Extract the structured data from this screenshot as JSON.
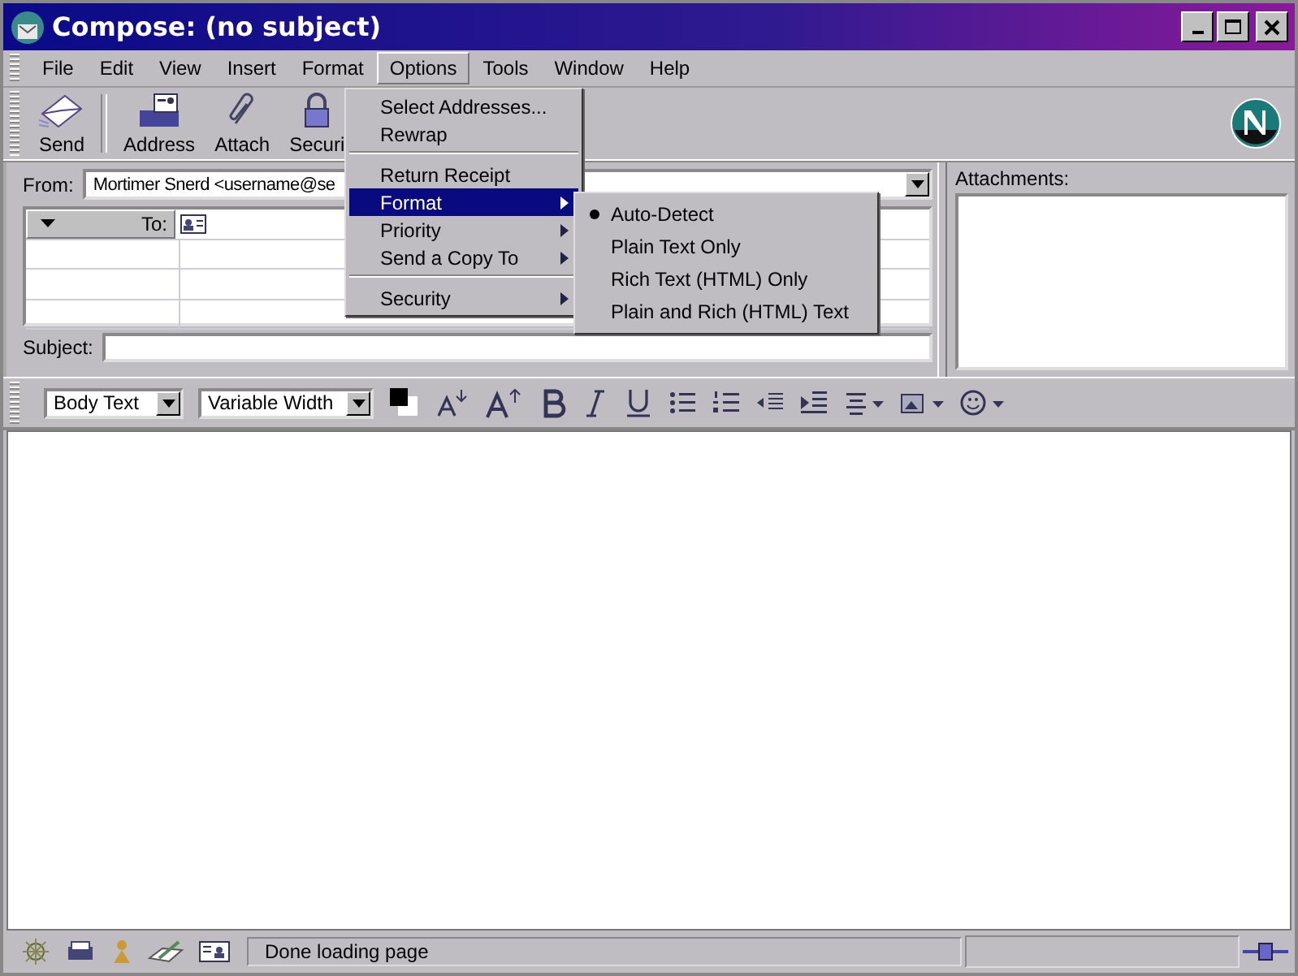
{
  "window": {
    "title": "Compose: (no subject)"
  },
  "menubar": [
    {
      "label": "File",
      "selected": false
    },
    {
      "label": "Edit",
      "selected": false
    },
    {
      "label": "View",
      "selected": false
    },
    {
      "label": "Insert",
      "selected": false
    },
    {
      "label": "Format",
      "selected": false
    },
    {
      "label": "Options",
      "selected": true
    },
    {
      "label": "Tools",
      "selected": false
    },
    {
      "label": "Window",
      "selected": false
    },
    {
      "label": "Help",
      "selected": false
    }
  ],
  "toolbar": [
    {
      "label": "Send",
      "kind": "send"
    },
    {
      "label": "Address",
      "kind": "address"
    },
    {
      "label": "Attach",
      "kind": "attach"
    },
    {
      "label": "Securi",
      "kind": "security"
    }
  ],
  "options_menu": [
    {
      "label": "Select Addresses...",
      "submenu": false,
      "selected": false,
      "separator_after": false
    },
    {
      "label": "Rewrap",
      "submenu": false,
      "selected": false,
      "separator_after": true
    },
    {
      "label": "Return Receipt",
      "submenu": false,
      "selected": false,
      "separator_after": false
    },
    {
      "label": "Format",
      "submenu": true,
      "selected": true,
      "separator_after": false
    },
    {
      "label": "Priority",
      "submenu": true,
      "selected": false,
      "separator_after": false
    },
    {
      "label": "Send a Copy To",
      "submenu": true,
      "selected": false,
      "separator_after": true
    },
    {
      "label": "Security",
      "submenu": true,
      "selected": false,
      "separator_after": false
    }
  ],
  "format_submenu": [
    {
      "label": "Auto-Detect",
      "checked": true
    },
    {
      "label": "Plain Text Only",
      "checked": false
    },
    {
      "label": "Rich Text (HTML) Only",
      "checked": false
    },
    {
      "label": "Plain and Rich (HTML) Text",
      "checked": false
    }
  ],
  "from": {
    "label": "From:",
    "value": "Mortimer Snerd <username@se"
  },
  "recipients": {
    "header": "To:"
  },
  "subject": {
    "label": "Subject:"
  },
  "attachments": {
    "label": "Attachments:"
  },
  "format_bar": {
    "paragraph": "Body Text",
    "font": "Variable Width"
  },
  "status_bar": {
    "text": "Done loading page"
  }
}
